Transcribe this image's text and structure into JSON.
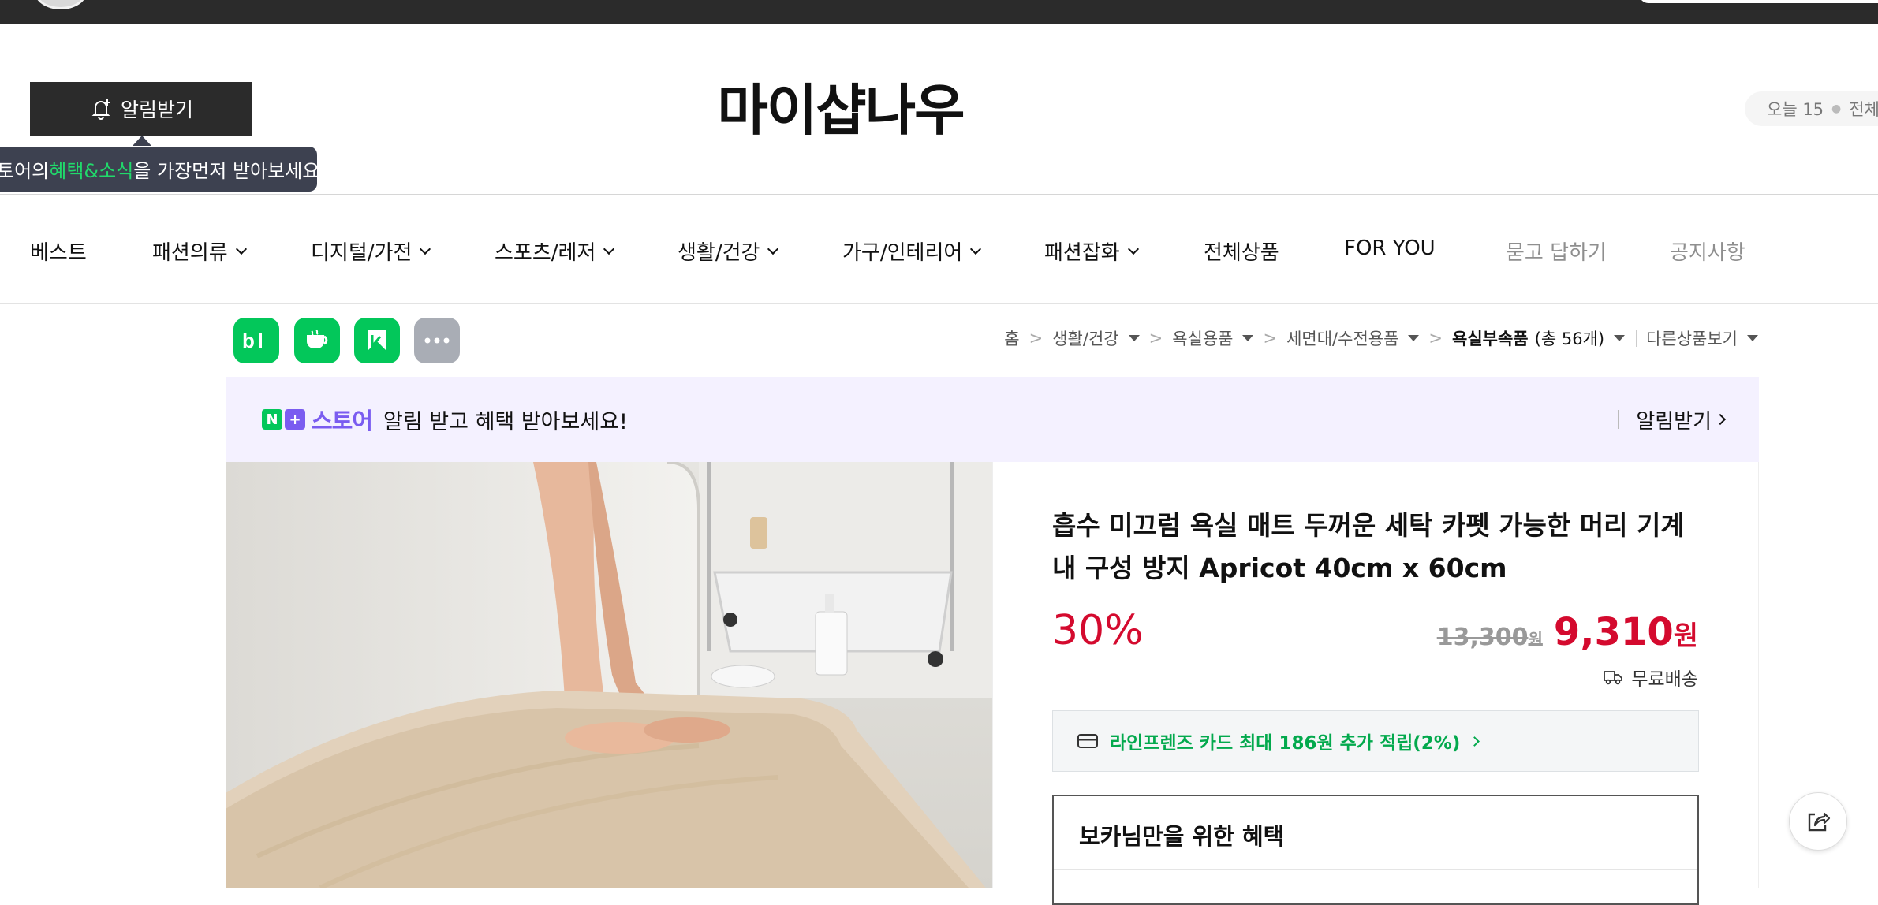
{
  "header": {
    "alarm_button_label": "알림받기",
    "tooltip_prefix": "토어의 ",
    "tooltip_highlight": "혜택&소식",
    "tooltip_suffix": "을 가장먼저 받아보세요!",
    "store_name": "마이샵나우",
    "visits_today_label": "오늘 15",
    "visits_total_label": "전체"
  },
  "nav": {
    "items": [
      {
        "label": "베스트"
      },
      {
        "label": "패션의류"
      },
      {
        "label": "디지털/가전"
      },
      {
        "label": "스포츠/레저"
      },
      {
        "label": "생활/건강"
      },
      {
        "label": "가구/인테리어"
      },
      {
        "label": "패션잡화"
      },
      {
        "label": "전체상품"
      },
      {
        "label": "FOR YOU"
      },
      {
        "label": "묻고 답하기"
      },
      {
        "label": "공지사항"
      }
    ]
  },
  "app_icons": [
    "blog-icon",
    "cafe-icon",
    "kakao-k-icon",
    "more-icon"
  ],
  "breadcrumb": {
    "home": "홈",
    "c1": "생활/건강",
    "c2": "욕실용품",
    "c3": "세면대/수전용품",
    "c4": "욕실부속품",
    "c4_count": "(총 56개)",
    "other": "다른상품보기"
  },
  "banner": {
    "n_badge": "N",
    "plus_badge": "+",
    "store_word": "스토어",
    "message": "알림 받고 혜택 받아보세요!",
    "action": "알림받기"
  },
  "product": {
    "title": "흡수 미끄럼 욕실 매트 두꺼운 세탁 카펫 가능한 머리 기계 내 구성 방지 Apricot 40cm x 60cm",
    "discount": "30%",
    "original_price": "13,300",
    "original_unit": "원",
    "sale_price": "9,310",
    "sale_unit": "원",
    "shipping": "무료배송",
    "card_benefit": "라인프렌즈 카드 최대 186원 추가 적립(2%)",
    "benefit_title": "보카님만을 위한 혜택"
  },
  "colors": {
    "accent_green": "#03c75a",
    "sale_red": "#d40a2e",
    "store_purple": "#7a5cf0",
    "dark_bar": "#2b2b2b"
  }
}
